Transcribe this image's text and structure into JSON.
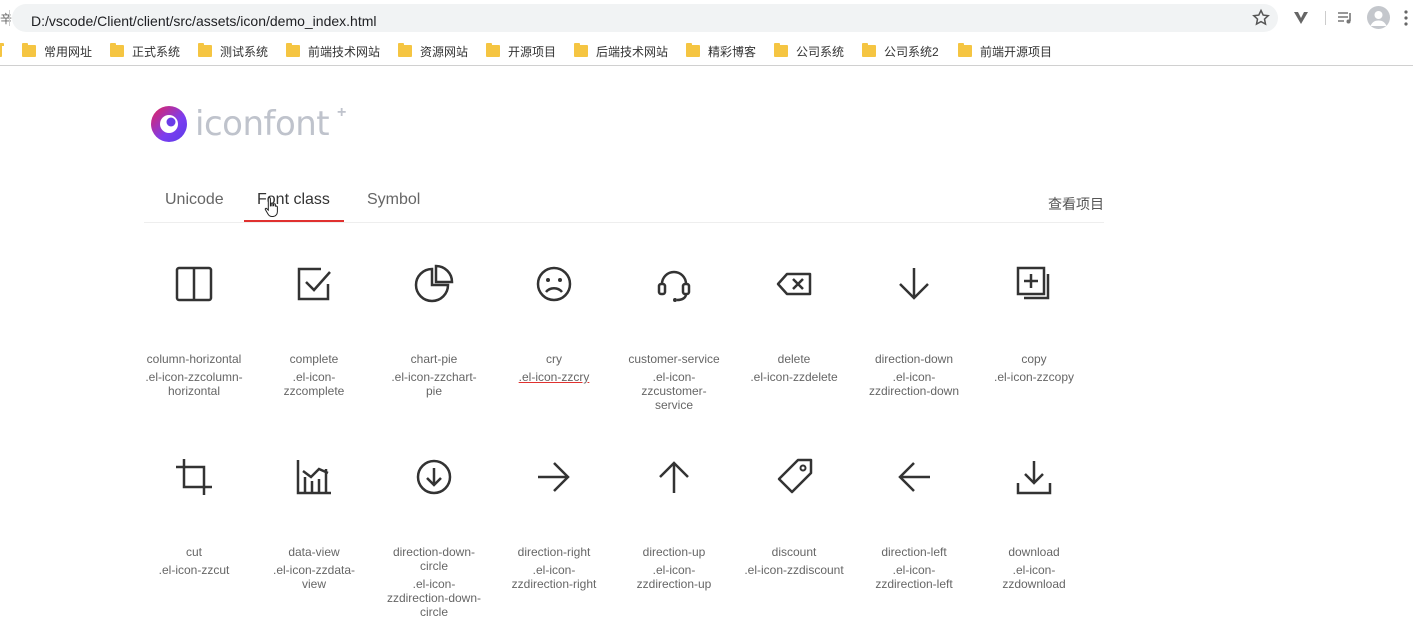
{
  "browser": {
    "url": "D:/vscode/Client/client/src/assets/icon/demo_index.html",
    "left_edge_glyph": "辛",
    "bookmarks": [
      "常用网址",
      "正式系统",
      "测试系统",
      "前端技术网站",
      "资源网站",
      "开源项目",
      "后端技术网站",
      "精彩博客",
      "公司系统",
      "公司系统2",
      "前端开源项目"
    ]
  },
  "page": {
    "logo_text": "iconfont",
    "logo_plus": "+",
    "tabs": [
      "Unicode",
      "Font class",
      "Symbol"
    ],
    "active_tab": "Font class",
    "view_project": "查看项目",
    "icons": [
      {
        "name": "column-horizontal",
        "cls": ".el-icon-zzcolumn-horizontal",
        "icon": "column-horizontal-icon"
      },
      {
        "name": "complete",
        "cls": ".el-icon-zzcomplete",
        "icon": "complete-icon"
      },
      {
        "name": "chart-pie",
        "cls": ".el-icon-zzchart-pie",
        "icon": "chart-pie-icon"
      },
      {
        "name": "cry",
        "cls": ".el-icon-zzcry",
        "icon": "cry-icon"
      },
      {
        "name": "customer-service",
        "cls": ".el-icon-zzcustomer-service",
        "icon": "customer-service-icon"
      },
      {
        "name": "delete",
        "cls": ".el-icon-zzdelete",
        "icon": "delete-icon"
      },
      {
        "name": "direction-down",
        "cls": ".el-icon-zzdirection-down",
        "icon": "direction-down-icon"
      },
      {
        "name": "copy",
        "cls": ".el-icon-zzcopy",
        "icon": "copy-icon"
      },
      {
        "name": "cut",
        "cls": ".el-icon-zzcut",
        "icon": "cut-icon"
      },
      {
        "name": "data-view",
        "cls": ".el-icon-zzdata-view",
        "icon": "data-view-icon"
      },
      {
        "name": "direction-down-circle",
        "cls": ".el-icon-zzdirection-down-circle",
        "icon": "direction-down-circle-icon"
      },
      {
        "name": "direction-right",
        "cls": ".el-icon-zzdirection-right",
        "icon": "direction-right-icon"
      },
      {
        "name": "direction-up",
        "cls": ".el-icon-zzdirection-up",
        "icon": "direction-up-icon"
      },
      {
        "name": "discount",
        "cls": ".el-icon-zzdiscount",
        "icon": "discount-icon"
      },
      {
        "name": "direction-left",
        "cls": ".el-icon-zzdirection-left",
        "icon": "direction-left-icon"
      },
      {
        "name": "download",
        "cls": ".el-icon-zzdownload",
        "icon": "download-icon"
      }
    ]
  },
  "colors": {
    "accent": "#e0312f",
    "icon_stroke": "#333333",
    "text": "#666666"
  }
}
